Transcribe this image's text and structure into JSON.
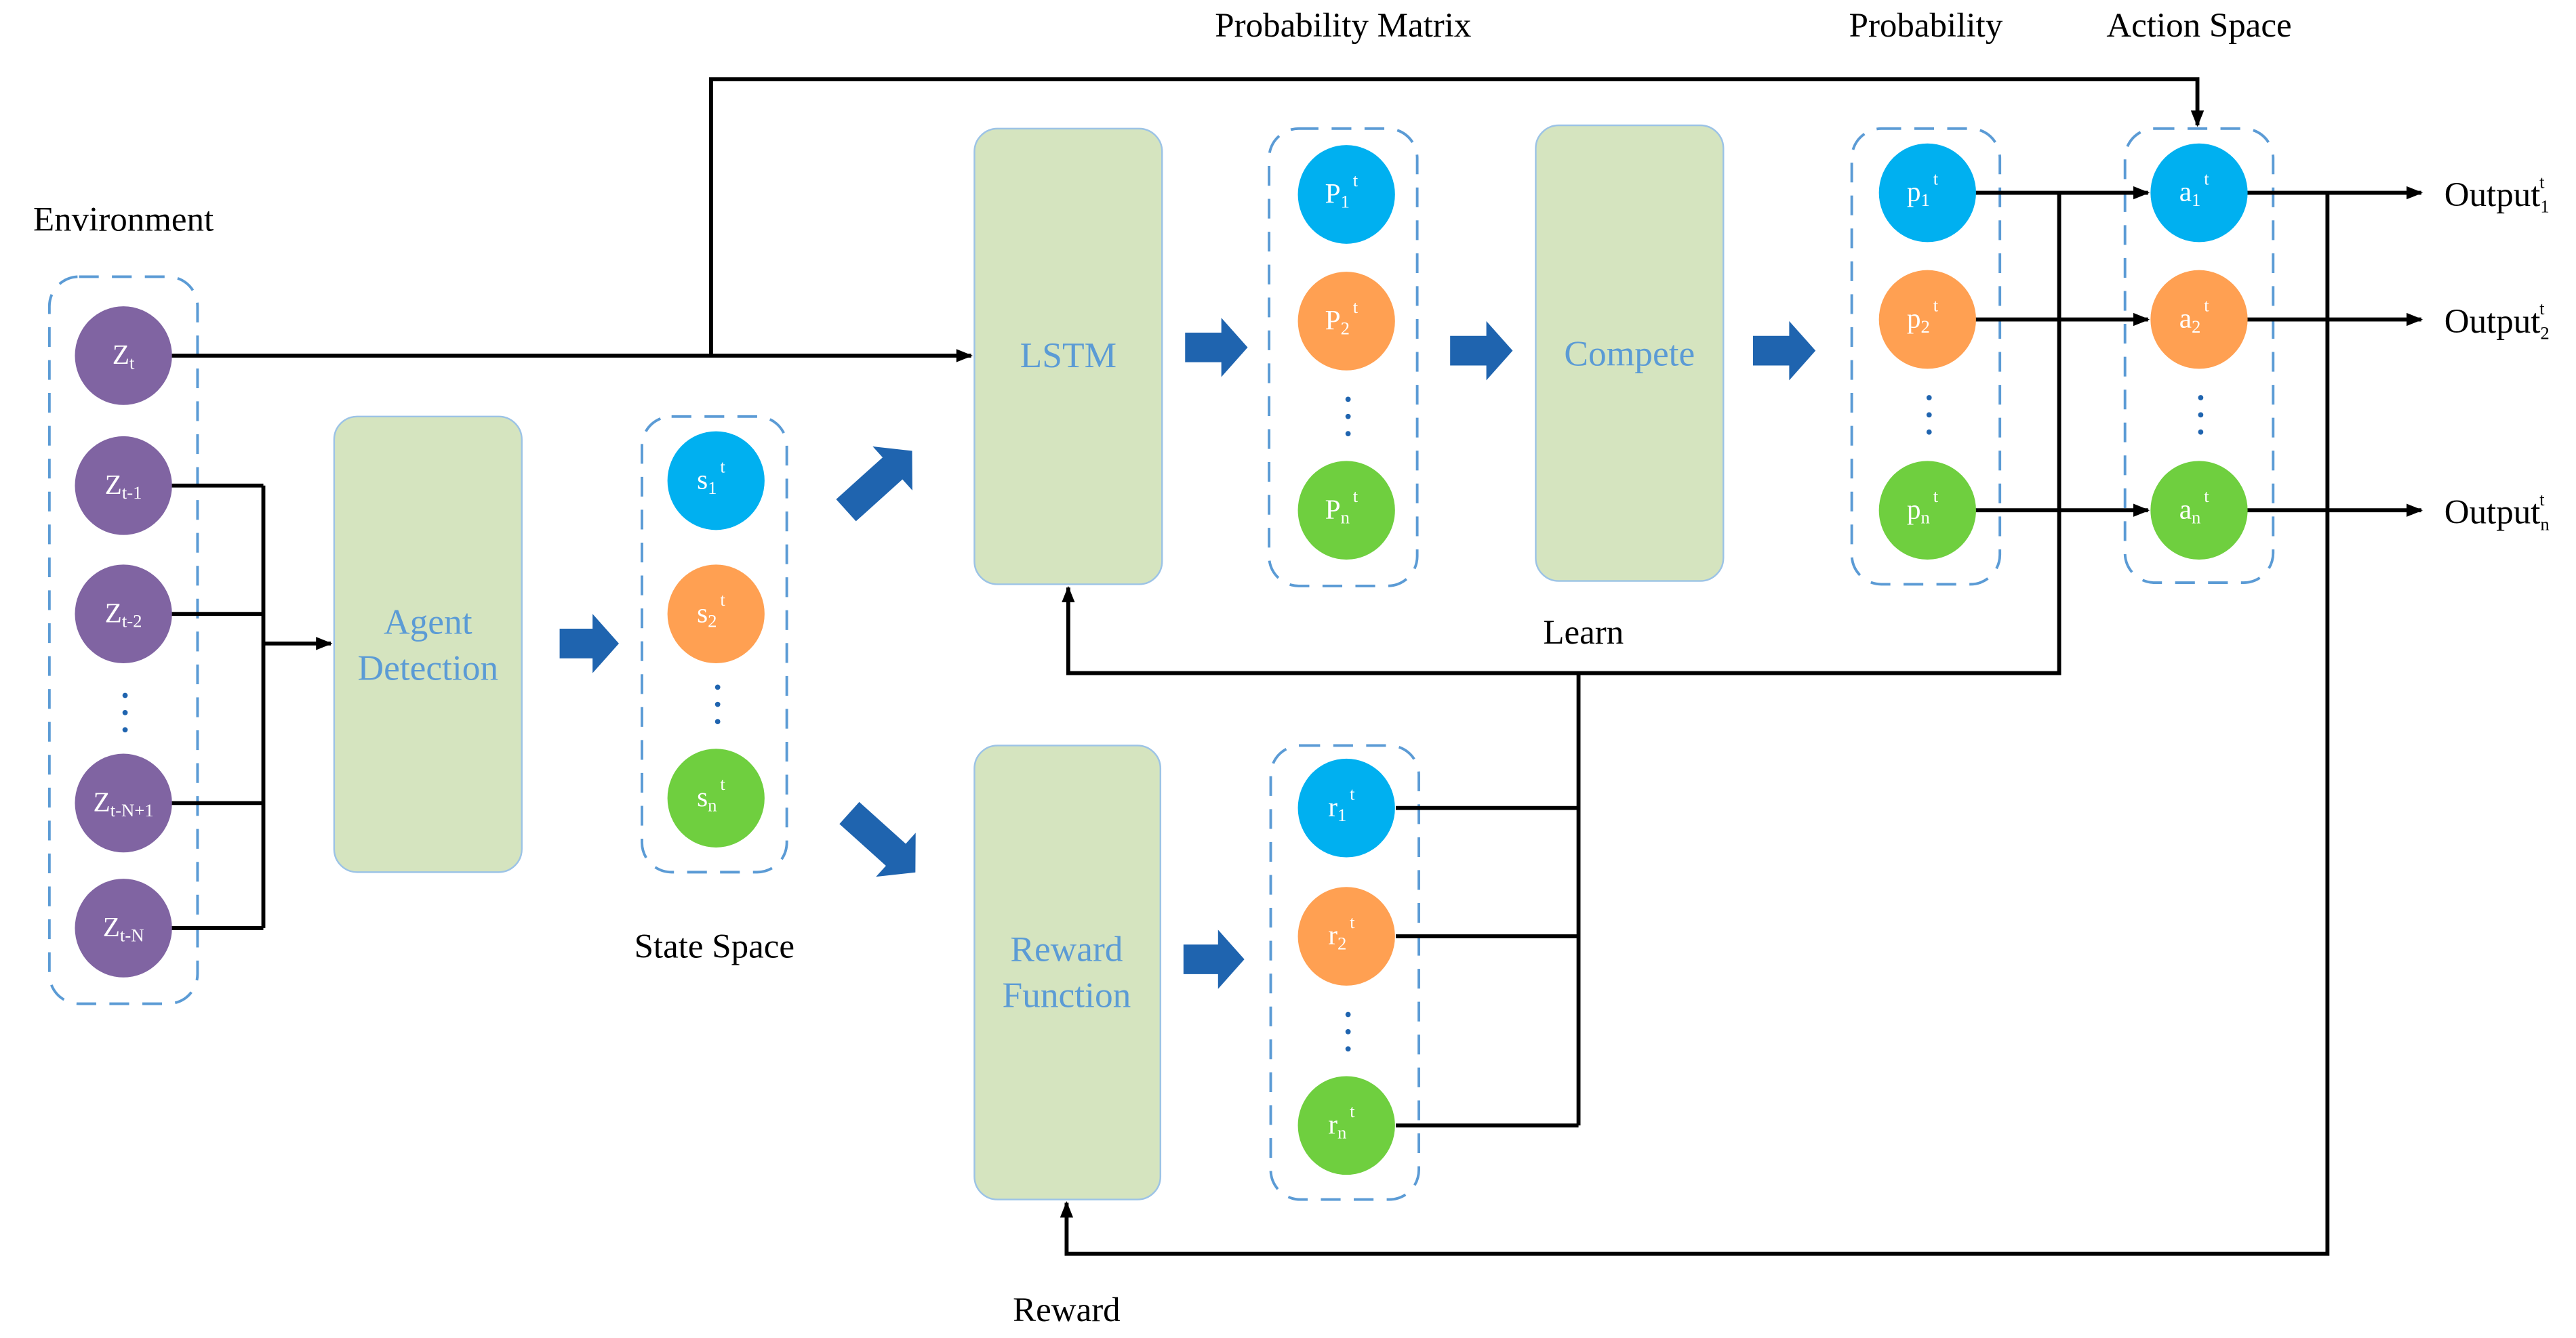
{
  "labels": {
    "environment": "Environment",
    "state_space": "State Space",
    "probability_matrix": "Probability Matrix",
    "probability": "Probability",
    "action_space": "Action Space",
    "learn": "Learn",
    "reward": "Reward"
  },
  "boxes": {
    "agent_detection": [
      "Agent",
      "Detection"
    ],
    "lstm": "LSTM",
    "compete": "Compete",
    "reward_function": [
      "Reward",
      "Function"
    ]
  },
  "colors": {
    "purple": "#8064A2",
    "blue": "#00B0F0",
    "orange": "#FFA052",
    "green": "#6FCF3F",
    "box_fill": "#D5E4BF",
    "arrow_blue": "#1F64AF",
    "dash": "#5B9BD5"
  },
  "groups": {
    "environment": [
      {
        "base": "Z",
        "sub": "t",
        "sup": "",
        "color": "purple"
      },
      {
        "base": "Z",
        "sub": "t-1",
        "sup": "",
        "color": "purple"
      },
      {
        "base": "Z",
        "sub": "t-2",
        "sup": "",
        "color": "purple"
      },
      {
        "base": "Z",
        "sub": "t-N+1",
        "sup": "",
        "color": "purple"
      },
      {
        "base": "Z",
        "sub": "t-N",
        "sup": "",
        "color": "purple"
      }
    ],
    "state": [
      {
        "base": "s",
        "sub": "1",
        "sup": "t",
        "color": "blue"
      },
      {
        "base": "s",
        "sub": "2",
        "sup": "t",
        "color": "orange"
      },
      {
        "base": "s",
        "sub": "n",
        "sup": "t",
        "color": "green"
      }
    ],
    "prob_matrix": [
      {
        "base": "P",
        "sub": "1",
        "sup": "t",
        "color": "blue"
      },
      {
        "base": "P",
        "sub": "2",
        "sup": "t",
        "color": "orange"
      },
      {
        "base": "P",
        "sub": "n",
        "sup": "t",
        "color": "green"
      }
    ],
    "probability": [
      {
        "base": "p",
        "sub": "1",
        "sup": "t",
        "color": "blue"
      },
      {
        "base": "p",
        "sub": "2",
        "sup": "t",
        "color": "orange"
      },
      {
        "base": "p",
        "sub": "n",
        "sup": "t",
        "color": "green"
      }
    ],
    "action": [
      {
        "base": "a",
        "sub": "1",
        "sup": "t",
        "color": "blue"
      },
      {
        "base": "a",
        "sub": "2",
        "sup": "t",
        "color": "orange"
      },
      {
        "base": "a",
        "sub": "n",
        "sup": "t",
        "color": "green"
      }
    ],
    "reward": [
      {
        "base": "r",
        "sub": "1",
        "sup": "t",
        "color": "blue"
      },
      {
        "base": "r",
        "sub": "2",
        "sup": "t",
        "color": "orange"
      },
      {
        "base": "r",
        "sub": "n",
        "sup": "t",
        "color": "green"
      }
    ]
  },
  "outputs": [
    {
      "base": "Output",
      "sub": "1",
      "sup": "t"
    },
    {
      "base": "Output",
      "sub": "2",
      "sup": "t"
    },
    {
      "base": "Output",
      "sub": "n",
      "sup": "t"
    }
  ]
}
